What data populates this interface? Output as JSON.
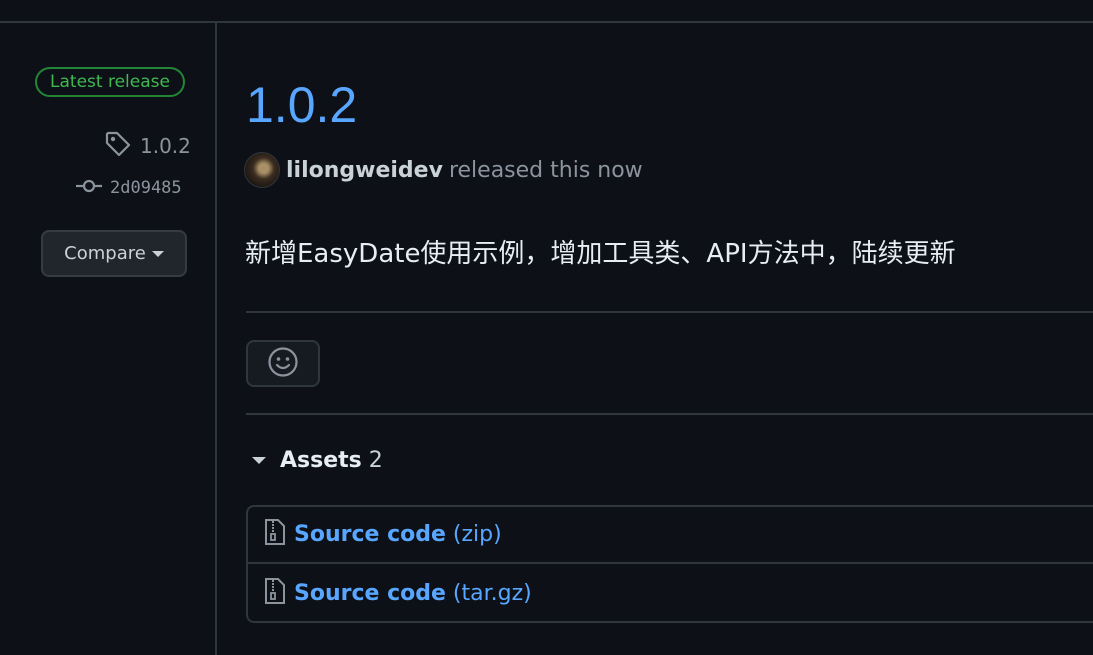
{
  "sidebar": {
    "badge": "Latest release",
    "tag": "1.0.2",
    "commit": "2d09485",
    "compare_label": "Compare"
  },
  "release": {
    "title": "1.0.2",
    "author": "lilongweidev",
    "action": "released this now",
    "notes": "新增EasyDate使用示例，增加工具类、API方法中，陆续更新"
  },
  "assets": {
    "label": "Assets",
    "count": "2",
    "items": [
      {
        "name": "Source code",
        "ext": "(zip)"
      },
      {
        "name": "Source code",
        "ext": "(tar.gz)"
      }
    ]
  },
  "icons": {
    "tag": "tag-icon",
    "commit": "git-commit-icon",
    "reaction": "smiley-icon",
    "file": "file-zip-icon",
    "caret": "triangle-down-icon"
  },
  "colors": {
    "background": "#0d1117",
    "link": "#58a6ff",
    "badge_green": "#3fb950",
    "border": "#30363d",
    "muted": "#8b949e"
  }
}
